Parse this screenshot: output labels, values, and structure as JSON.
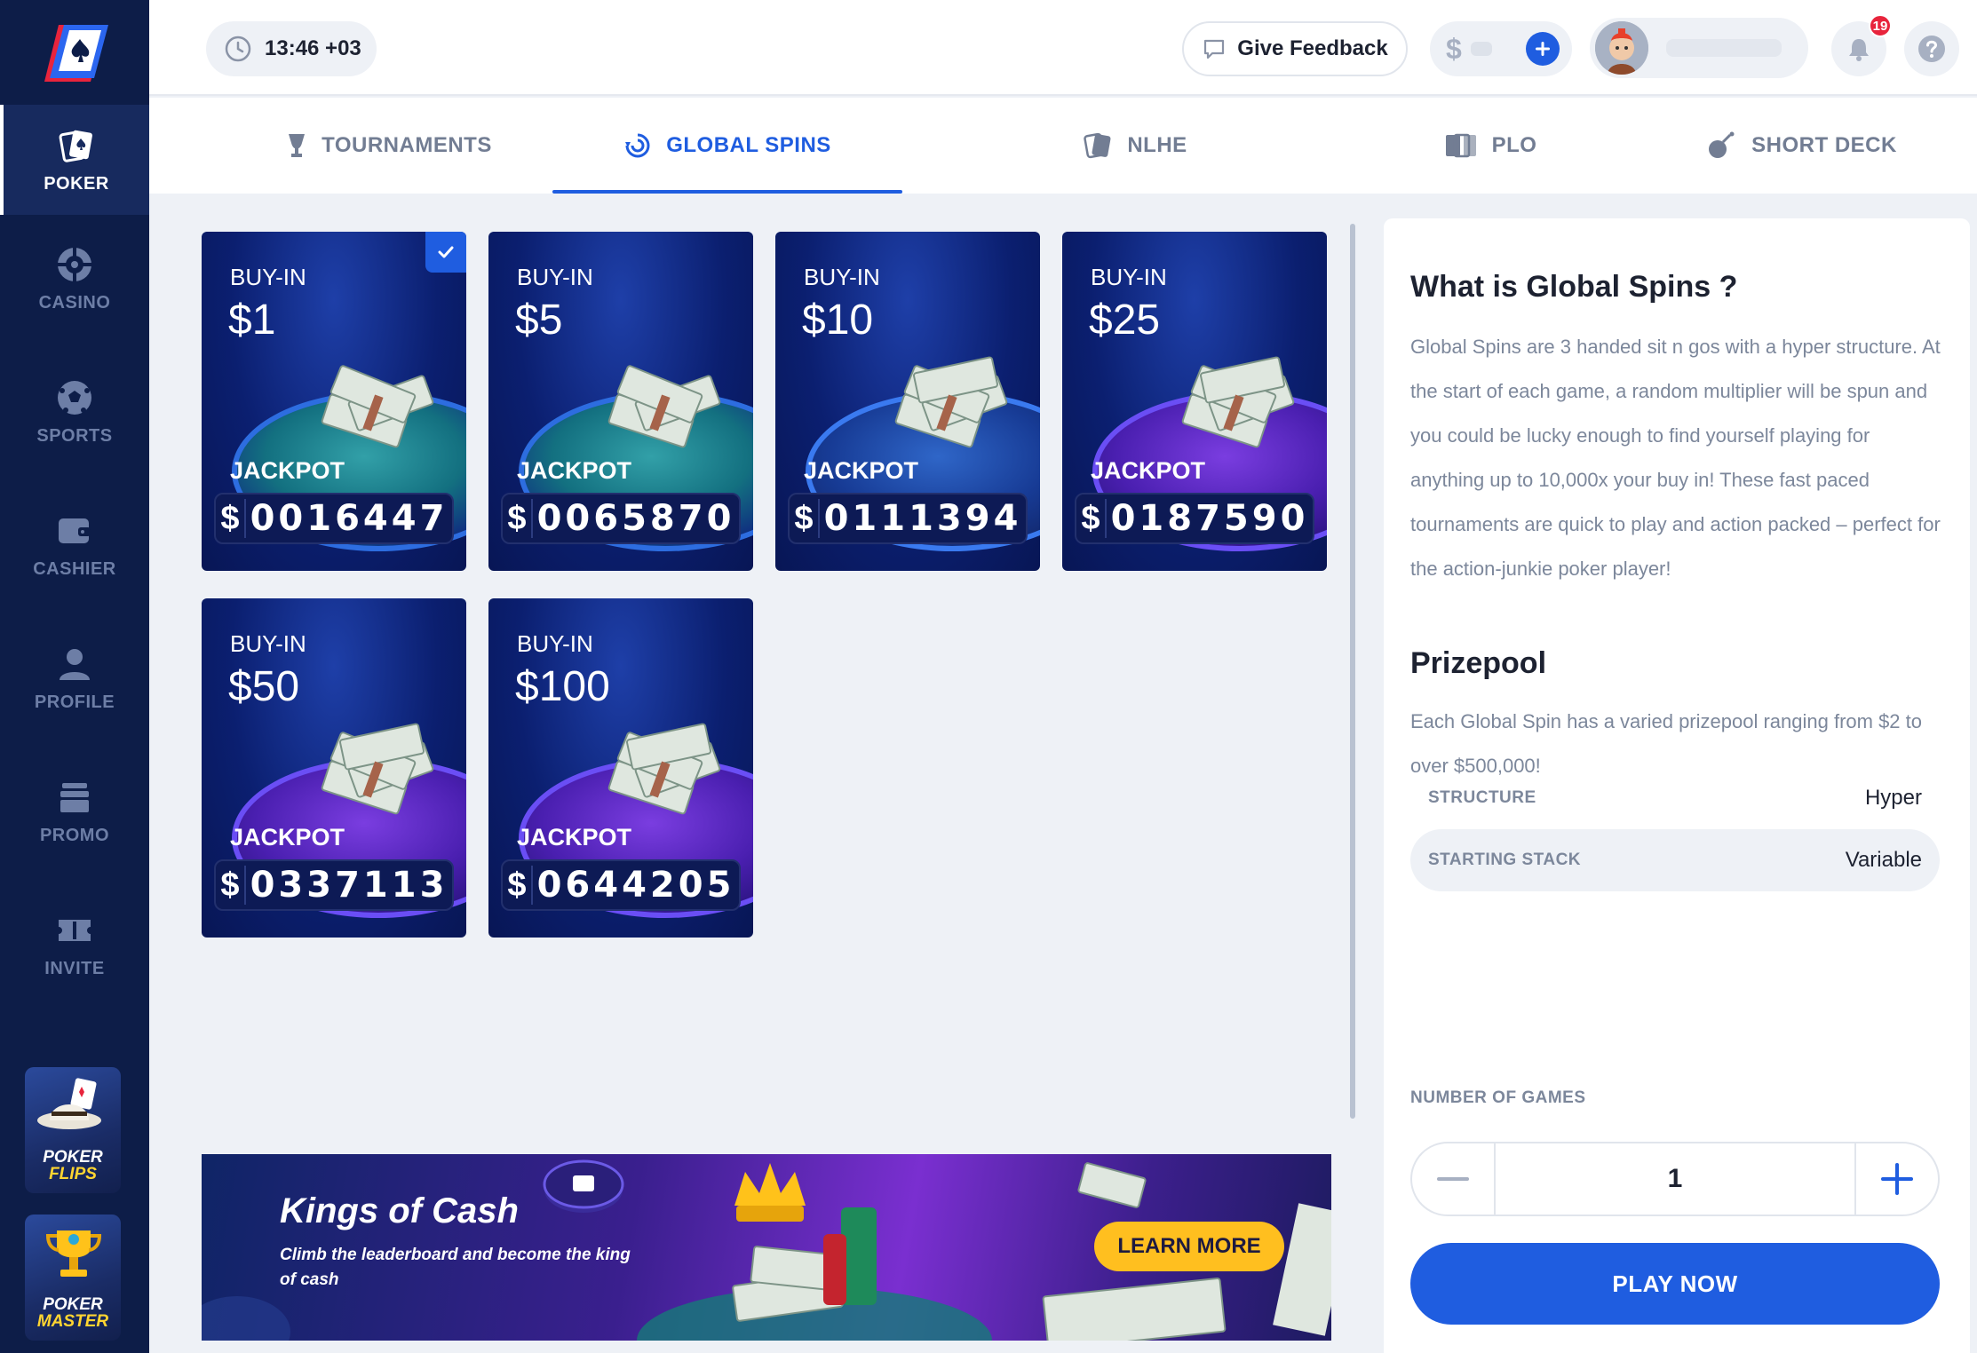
{
  "sidebar": {
    "items": [
      {
        "label": "POKER",
        "icon": "poker-cards-icon",
        "active": true
      },
      {
        "label": "CASINO",
        "icon": "roulette-icon"
      },
      {
        "label": "SPORTS",
        "icon": "soccer-ball-icon"
      },
      {
        "label": "CASHIER",
        "icon": "wallet-icon"
      },
      {
        "label": "PROFILE",
        "icon": "user-icon"
      },
      {
        "label": "PROMO",
        "icon": "gift-icon"
      },
      {
        "label": "INVITE",
        "icon": "ticket-icon"
      }
    ],
    "promos": [
      {
        "line1": "POKER",
        "line2": "FLIPS",
        "icon": "cowboy-hat-icon"
      },
      {
        "line1": "POKER",
        "line2": "MASTER",
        "icon": "trophy-icon"
      }
    ]
  },
  "header": {
    "time": "13:46 +03",
    "feedback_label": "Give Feedback",
    "currency_symbol": "$",
    "notification_count": "19"
  },
  "tabs": [
    {
      "label": "TOURNAMENTS",
      "icon": "trophy-icon"
    },
    {
      "label": "GLOBAL SPINS",
      "icon": "spin-icon",
      "active": true
    },
    {
      "label": "NLHE",
      "icon": "card-icon"
    },
    {
      "label": "PLO",
      "icon": "cards-icon"
    },
    {
      "label": "SHORT DECK",
      "icon": "cards-bomb-icon"
    }
  ],
  "cards": [
    {
      "buyin_label": "BUY-IN",
      "buyin": "$1",
      "jackpot_label": "JACKPOT",
      "currency": "$",
      "jackpot": "0016447",
      "selected": true
    },
    {
      "buyin_label": "BUY-IN",
      "buyin": "$5",
      "jackpot_label": "JACKPOT",
      "currency": "$",
      "jackpot": "0065870"
    },
    {
      "buyin_label": "BUY-IN",
      "buyin": "$10",
      "jackpot_label": "JACKPOT",
      "currency": "$",
      "jackpot": "0111394"
    },
    {
      "buyin_label": "BUY-IN",
      "buyin": "$25",
      "jackpot_label": "JACKPOT",
      "currency": "$",
      "jackpot": "0187590"
    },
    {
      "buyin_label": "BUY-IN",
      "buyin": "$50",
      "jackpot_label": "JACKPOT",
      "currency": "$",
      "jackpot": "0337113"
    },
    {
      "buyin_label": "BUY-IN",
      "buyin": "$100",
      "jackpot_label": "JACKPOT",
      "currency": "$",
      "jackpot": "0644205"
    }
  ],
  "banner": {
    "title": "Kings of Cash",
    "subtitle": "Climb the leaderboard and become the king of cash",
    "cta": "LEARN MORE"
  },
  "info": {
    "title": "What is Global Spins ?",
    "description": "Global Spins are 3 handed sit n gos with a hyper structure. At the start of each game, a random multiplier will be spun and you could be lucky enough to find yourself playing for anything up to 10,000x your buy in! These fast paced tournaments are quick to play and action packed – perfect for the action-junkie poker player!",
    "prize_title": "Prizepool",
    "prize_description": "Each Global Spin has a varied prizepool ranging from $2 to over $500,000!",
    "stats": [
      {
        "key": "STRUCTURE",
        "value": "Hyper"
      },
      {
        "key": "STARTING STACK",
        "value": "Variable"
      }
    ],
    "games_label": "NUMBER OF GAMES",
    "games_value": "1",
    "play_label": "PLAY NOW"
  },
  "colors": {
    "sidebar_bg": "#0d1d48",
    "accent": "#1f5de0",
    "cta_yellow": "#ffbf1f",
    "badge_red": "#e8243c"
  }
}
